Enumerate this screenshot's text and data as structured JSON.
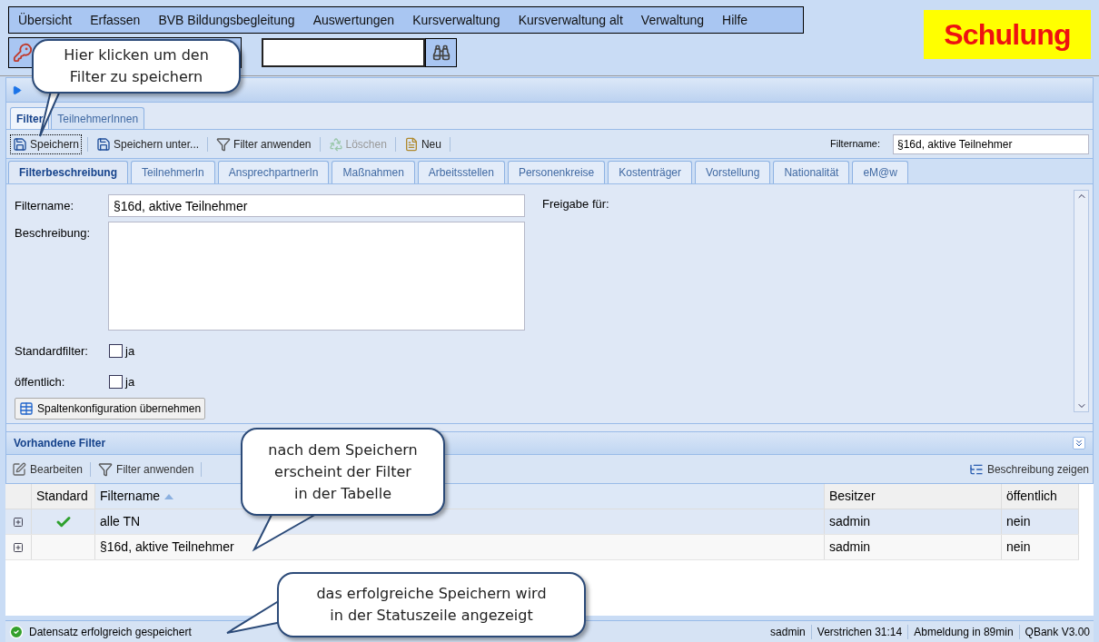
{
  "menu": {
    "items": [
      "Übersicht",
      "Erfassen",
      "BVB Bildungsbegleitung",
      "Auswertungen",
      "Kursverwaltung",
      "Kursverwaltung alt",
      "Verwaltung",
      "Hilfe"
    ]
  },
  "badge": "Schulung",
  "main_tabs": [
    {
      "label": "Filter",
      "selected": true
    },
    {
      "label": "TeilnehmerInnen",
      "selected": false
    }
  ],
  "toolbar": [
    {
      "label": "Speichern",
      "disabled": false,
      "focused": true
    },
    {
      "label": "Speichern unter...",
      "disabled": false,
      "focused": false
    },
    {
      "label": "Filter anwenden",
      "disabled": false,
      "focused": false
    },
    {
      "label": "Löschen",
      "disabled": true,
      "focused": false
    },
    {
      "label": "Neu",
      "disabled": false,
      "focused": false
    }
  ],
  "filtername_field": {
    "label": "Filtername:",
    "value": "§16d, aktive Teilnehmer"
  },
  "sub_tabs": [
    {
      "label": "Filterbeschreibung",
      "selected": true
    },
    {
      "label": "TeilnehmerIn",
      "selected": false
    },
    {
      "label": "AnsprechpartnerIn",
      "selected": false
    },
    {
      "label": "Maßnahmen",
      "selected": false
    },
    {
      "label": "Arbeitsstellen",
      "selected": false
    },
    {
      "label": "Personenkreise",
      "selected": false
    },
    {
      "label": "Kostenträger",
      "selected": false
    },
    {
      "label": "Vorstellung",
      "selected": false
    },
    {
      "label": "Nationalität",
      "selected": false
    },
    {
      "label": "eM@w",
      "selected": false
    }
  ],
  "form": {
    "filtername": {
      "label": "Filtername:",
      "value": "§16d, aktive Teilnehmer"
    },
    "beschreibung": {
      "label": "Beschreibung:"
    },
    "checkboxes": [
      {
        "label": "Standardfilter:",
        "option": "ja",
        "checked": false
      },
      {
        "label": "öffentlich:",
        "option": "ja",
        "checked": false
      }
    ],
    "freigabe_label": "Freigabe für:",
    "button": "Spaltenkonfiguration übernehmen"
  },
  "existing_filters": {
    "title": "Vorhandene Filter",
    "toolbar": [
      "Bearbeiten",
      "Filter anwenden"
    ],
    "right_button": "Beschreibung zeigen",
    "columns": [
      "Standard",
      "Filtername",
      "Besitzer",
      "öffentlich"
    ],
    "rows": [
      {
        "standard": true,
        "name": "alle TN",
        "owner": "sadmin",
        "public": "nein",
        "selected": true
      },
      {
        "standard": false,
        "name": "§16d, aktive Teilnehmer",
        "owner": "sadmin",
        "public": "nein",
        "selected": false
      }
    ]
  },
  "status_bar": {
    "message": "Datensatz erfolgreich gespeichert",
    "items": [
      "sadmin",
      "Verstrichen 31:14",
      "Abmeldung in 89min",
      "QBank V3.00"
    ]
  },
  "callouts": [
    {
      "lines": [
        "Hier klicken um den",
        "Filter zu speichern"
      ]
    },
    {
      "lines": [
        "nach dem Speichern",
        "erscheint der Filter",
        "in der Tabelle"
      ]
    },
    {
      "lines": [
        "das erfolgreiche Speichern wird",
        "in der Statuszeile angezeigt"
      ]
    }
  ]
}
